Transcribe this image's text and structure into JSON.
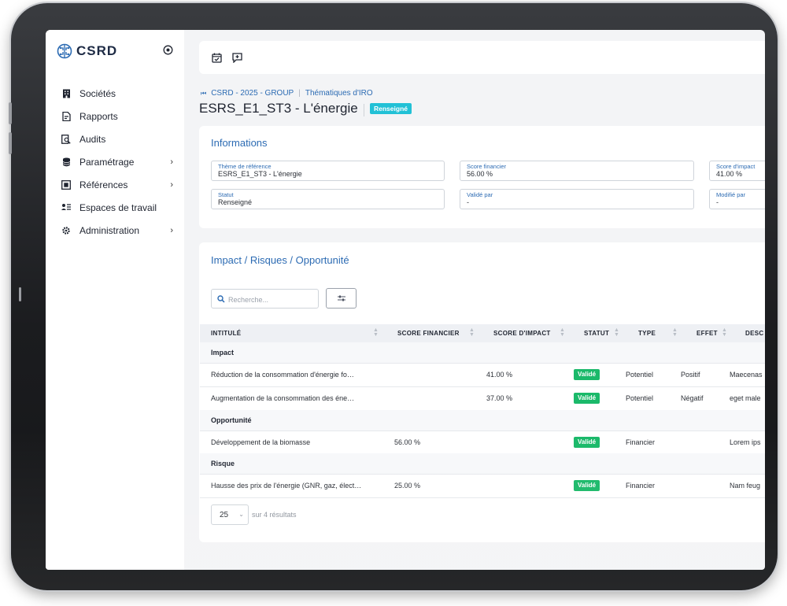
{
  "app": {
    "logo_text": "CSRD"
  },
  "sidebar": {
    "items": [
      {
        "label": "Sociétés",
        "icon": "building-icon",
        "has_submenu": false
      },
      {
        "label": "Rapports",
        "icon": "report-icon",
        "has_submenu": false
      },
      {
        "label": "Audits",
        "icon": "audit-icon",
        "has_submenu": false
      },
      {
        "label": "Paramétrage",
        "icon": "database-icon",
        "has_submenu": true
      },
      {
        "label": "Références",
        "icon": "reference-icon",
        "has_submenu": true
      },
      {
        "label": "Espaces de travail",
        "icon": "workspace-icon",
        "has_submenu": false
      },
      {
        "label": "Administration",
        "icon": "gear-icon",
        "has_submenu": true
      }
    ]
  },
  "breadcrumb": {
    "items": [
      "CSRD - 2025 - GROUP",
      "Thématiques d'IRO"
    ]
  },
  "page": {
    "title": "ESRS_E1_ST3 - L'énergie",
    "status": "Renseigné"
  },
  "informations": {
    "title": "Informations",
    "fields": {
      "theme": {
        "label": "Thème de référence",
        "value": "ESRS_E1_ST3 - L'énergie"
      },
      "score_financier": {
        "label": "Score financier",
        "value": "56.00 %"
      },
      "score_impact": {
        "label": "Score d'impact",
        "value": "41.00 %"
      },
      "statut": {
        "label": "Statut",
        "value": "Renseigné"
      },
      "valide_par": {
        "label": "Validé par",
        "value": "-"
      },
      "modifie_par": {
        "label": "Modifié par",
        "value": "-"
      }
    }
  },
  "iro": {
    "title": "Impact / Risques / Opportunité",
    "search_placeholder": "Recherche...",
    "columns": [
      "INTITULÉ",
      "SCORE FINANCIER",
      "SCORE D'IMPACT",
      "STATUT",
      "TYPE",
      "EFFET",
      "DESC"
    ],
    "groups": [
      {
        "label": "Impact",
        "rows": [
          {
            "intitule": "Réduction de la consommation d'énergie fo…",
            "score_financier": "",
            "score_impact": "41.00 %",
            "statut": "Validé",
            "type": "Potentiel",
            "effet": "Positif",
            "desc": "Maecenas"
          },
          {
            "intitule": "Augmentation de la consommation des éne…",
            "score_financier": "",
            "score_impact": "37.00 %",
            "statut": "Validé",
            "type": "Potentiel",
            "effet": "Négatif",
            "desc": "eget male"
          }
        ]
      },
      {
        "label": "Opportunité",
        "rows": [
          {
            "intitule": "Développement de la biomasse",
            "score_financier": "56.00 %",
            "score_impact": "",
            "statut": "Validé",
            "type": "Financier",
            "effet": "",
            "desc": "Lorem ips"
          }
        ]
      },
      {
        "label": "Risque",
        "rows": [
          {
            "intitule": "Hausse des prix de l'énergie (GNR, gaz, élect…",
            "score_financier": "25.00 %",
            "score_impact": "",
            "statut": "Validé",
            "type": "Financier",
            "effet": "",
            "desc": "Nam feug"
          }
        ]
      }
    ],
    "page_size": "25",
    "results_text": "sur 4 résultats"
  },
  "colors": {
    "accent": "#2c6bb3",
    "status_info": "#22c1d6",
    "status_valid": "#1bb96a"
  }
}
